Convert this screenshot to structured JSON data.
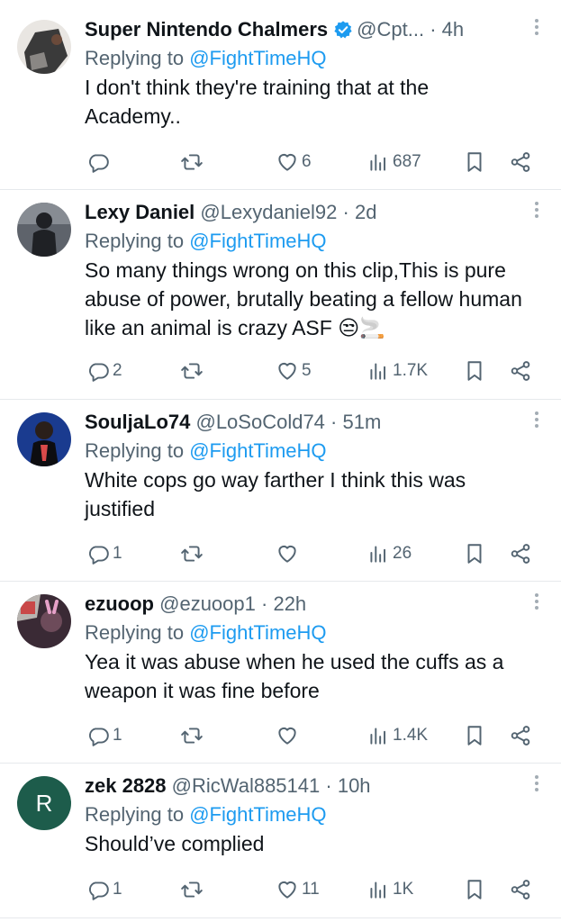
{
  "tweets": [
    {
      "name": "Super Nintendo Chalmers",
      "handle": "@Cpt...",
      "sep": "·",
      "time": "4h",
      "verified": true,
      "reply_prefix": "Replying to ",
      "reply_to": "@FightTimeHQ",
      "text": "I don't think they're training that at the Academy..",
      "replies": "",
      "retweets": "",
      "likes": "6",
      "views": "687",
      "avatar_color": "#3a3a3a"
    },
    {
      "name": "Lexy Daniel",
      "handle": "@Lexydaniel92",
      "sep": "·",
      "time": "2d",
      "verified": false,
      "reply_prefix": "Replying to ",
      "reply_to": "@FightTimeHQ",
      "text": "So many things wrong on this clip,This is pure abuse of power, brutally beating a fellow human like an animal is crazy ASF 😒🚬",
      "replies": "2",
      "retweets": "",
      "likes": "5",
      "views": "1.7K",
      "avatar_color": "#4b5058"
    },
    {
      "name": "SouljaLo74",
      "handle": "@LoSoCold74",
      "sep": "·",
      "time": "51m",
      "verified": false,
      "reply_prefix": "Replying to ",
      "reply_to": "@FightTimeHQ",
      "text": "White cops go way farther I think this was justified",
      "replies": "1",
      "retweets": "",
      "likes": "",
      "views": "26",
      "avatar_color": "#1a3b8f"
    },
    {
      "name": "ezuoop",
      "handle": "@ezuoop1",
      "sep": "·",
      "time": "22h",
      "verified": false,
      "reply_prefix": "Replying to ",
      "reply_to": "@FightTimeHQ",
      "text": "Yea it was abuse when he used the cuffs as a weapon it was fine before",
      "replies": "1",
      "retweets": "",
      "likes": "",
      "views": "1.4K",
      "avatar_color": "#5a2d3f"
    },
    {
      "name": "zek 2828",
      "handle": "@RicWal885141",
      "sep": "·",
      "time": "10h",
      "verified": false,
      "reply_prefix": "Replying to ",
      "reply_to": "@FightTimeHQ",
      "text": "Should’ve complied",
      "replies": "1",
      "retweets": "",
      "likes": "11",
      "views": "1K",
      "avatar_letter": "R",
      "avatar_color": "#1d5c4b"
    }
  ],
  "colors": {
    "accent": "#1d9bf0",
    "muted": "#536471",
    "text": "#0f1419",
    "divider": "#e6e9ec"
  }
}
